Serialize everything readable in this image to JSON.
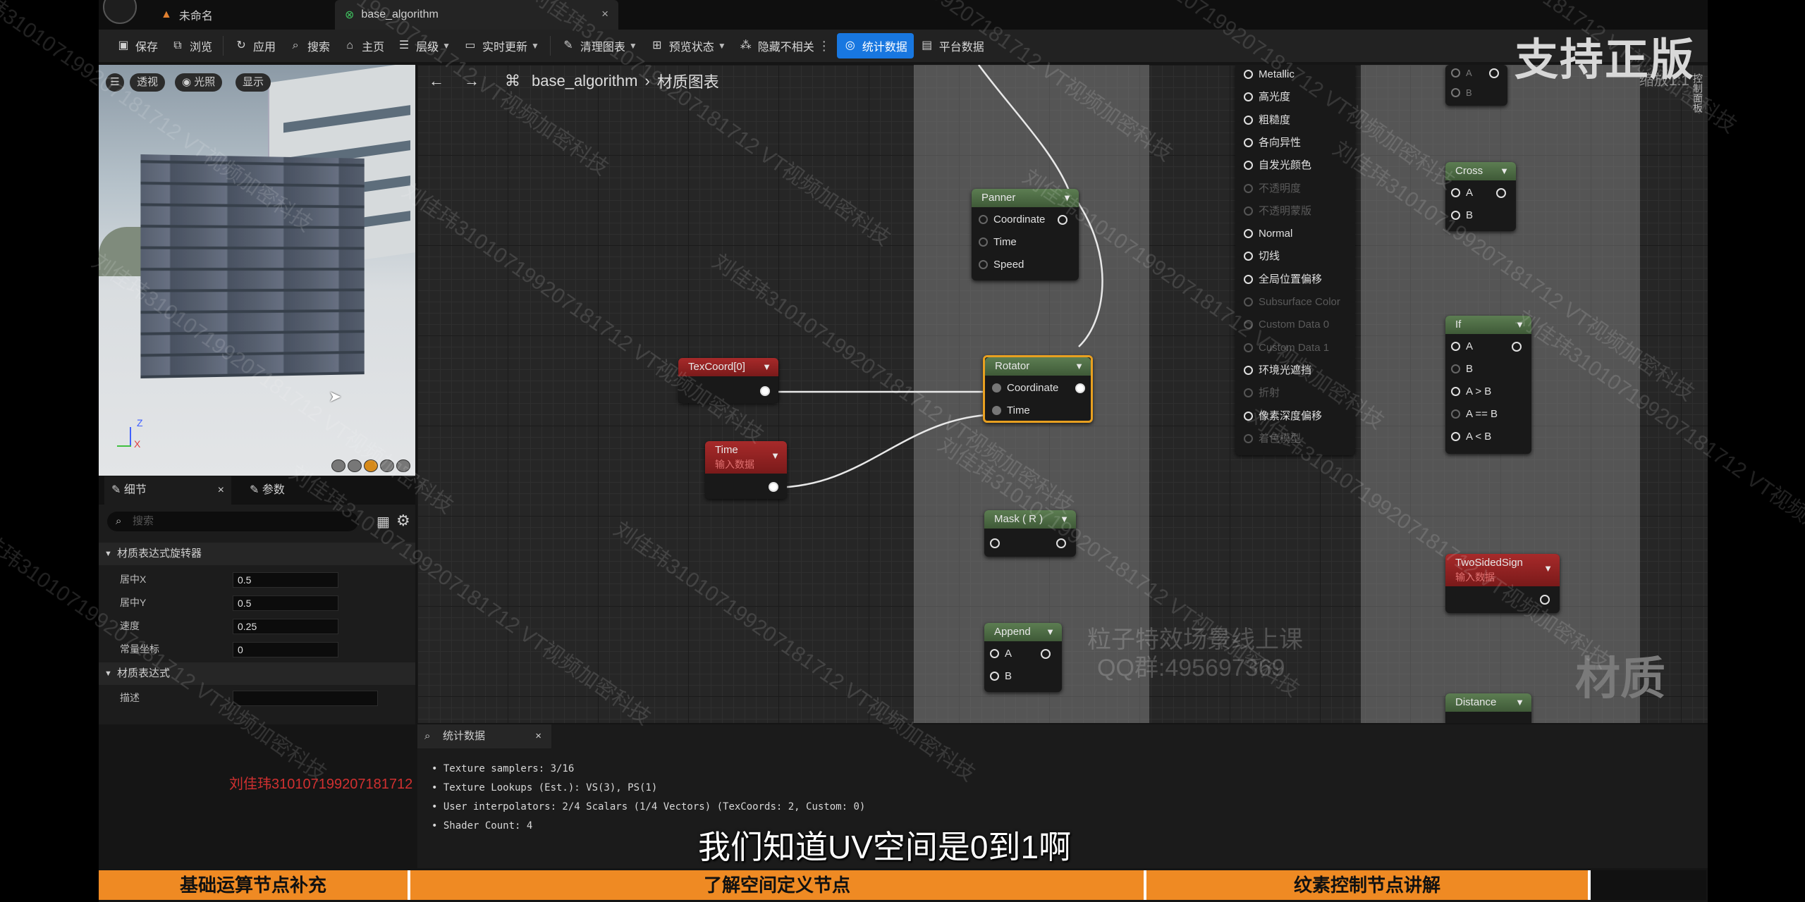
{
  "tabs": [
    {
      "label": "未命名"
    },
    {
      "label": "base_algorithm",
      "close": "×"
    }
  ],
  "toolbar": {
    "save": "保存",
    "browse": "浏览",
    "apply": "应用",
    "search": "搜索",
    "home": "主页",
    "hierarchy": "层级",
    "live_update": "实时更新",
    "clean_graph": "清理图表",
    "preview_state": "预览状态",
    "hide_unrelated": "隐藏不相关",
    "stats": "统计数据",
    "platform_stats": "平台数据"
  },
  "viewport": {
    "perspective": "透视",
    "lit": "光照",
    "show": "显示",
    "axis_z": "Z",
    "axis_x": "X"
  },
  "details": {
    "tab_details": "细节",
    "tab_params": "参数",
    "search_placeholder": "搜索",
    "section_rotator": "材质表达式旋转器",
    "props": [
      {
        "label": "居中X",
        "value": "0.5"
      },
      {
        "label": "居中Y",
        "value": "0.5"
      },
      {
        "label": "速度",
        "value": "0.25"
      },
      {
        "label": "常量坐标",
        "value": "0"
      }
    ],
    "section_expr": "材质表达式",
    "desc_label": "描述"
  },
  "graph": {
    "breadcrumb_root": "base_algorithm",
    "breadcrumb_sub": "材质图表",
    "zoom": "缩放1:1",
    "watermark": "材质",
    "material_panel_tab": "控制面板",
    "comment_watermark_line1": "粒子特效场景线上课",
    "comment_watermark_line2": "QQ群:495697369"
  },
  "nodes": {
    "panner": {
      "title": "Panner",
      "pins": [
        "Coordinate",
        "Time",
        "Speed"
      ]
    },
    "texcoord": {
      "title": "TexCoord[0]"
    },
    "time": {
      "title": "Time",
      "subtitle": "输入数据"
    },
    "rotator": {
      "title": "Rotator",
      "pins": [
        "Coordinate",
        "Time"
      ]
    },
    "mask": {
      "title": "Mask ( R )"
    },
    "append": {
      "title": "Append",
      "pins": [
        "A",
        "B"
      ]
    },
    "cross": {
      "title": "Cross",
      "pins": [
        "A",
        "B"
      ]
    },
    "if": {
      "title": "If",
      "pins": [
        "A",
        "B",
        "A > B",
        "A == B",
        "A < B"
      ]
    },
    "twosided": {
      "title": "TwoSidedSign",
      "subtitle": "输入数据"
    },
    "distance": {
      "title": "Distance"
    },
    "top_partial": {
      "pins": [
        "A",
        "B"
      ]
    }
  },
  "material_pins": [
    "Metallic",
    "高光度",
    "粗糙度",
    "各向异性",
    "自发光颜色",
    "不透明度",
    "不透明蒙版",
    "Normal",
    "切线",
    "全局位置偏移",
    "Subsurface Color",
    "Custom Data 0",
    "Custom Data 1",
    "环境光遮挡",
    "折射",
    "像素深度偏移",
    "着色模型"
  ],
  "stats_panel": {
    "tab": "统计数据",
    "close": "×",
    "lines": [
      "Texture samplers: 3/16",
      "Texture Lookups (Est.): VS(3), PS(1)",
      "User interpolators: 2/4 Scalars (1/4 Vectors) (TexCoords: 2, Custom: 0)",
      "Shader Count: 4"
    ]
  },
  "subtitle": "我们知道UV空间是0到1啊",
  "bottom_bar": [
    "基础运算节点补充",
    "了解空间定义节点",
    "纹素控制节点讲解"
  ],
  "overlay": {
    "support": "支持正版",
    "red_watermark": "刘佳玮310107199207181712",
    "diag_watermark": "刘佳玮310107199207181712 VT视频加密科技"
  }
}
